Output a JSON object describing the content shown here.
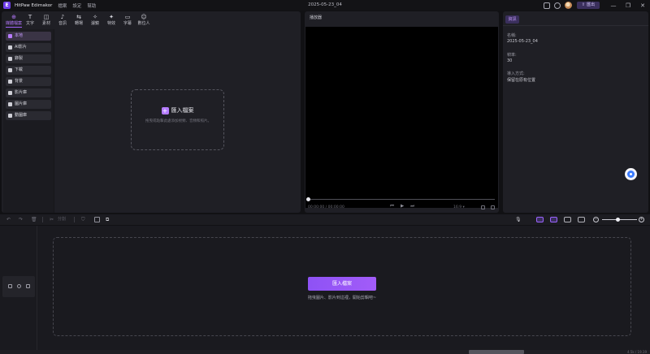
{
  "titlebar": {
    "app_name": "HitPaw Edimakor",
    "logo_letter": "E",
    "menus": [
      "檔案",
      "設定",
      "幫助"
    ],
    "document_title": "2025-05-23_04",
    "export_label": "匯出",
    "window_controls": [
      "—",
      "❐",
      "✕"
    ]
  },
  "toolbar": {
    "tools": [
      {
        "label": "媒體檔案",
        "icon": "media-icon",
        "glyph": "⊕",
        "active": true
      },
      {
        "label": "文字",
        "icon": "text-icon",
        "glyph": "T",
        "active": false
      },
      {
        "label": "素材",
        "icon": "sticker-icon",
        "glyph": "◫",
        "active": false
      },
      {
        "label": "音訊",
        "icon": "audio-icon",
        "glyph": "♪",
        "active": false
      },
      {
        "label": "轉場",
        "icon": "transition-icon",
        "glyph": "⇆",
        "active": false
      },
      {
        "label": "濾鏡",
        "icon": "filter-icon",
        "glyph": "✧",
        "active": false
      },
      {
        "label": "特效",
        "icon": "effect-icon",
        "glyph": "✦",
        "active": false
      },
      {
        "label": "字幕",
        "icon": "subtitle-icon",
        "glyph": "▭",
        "active": false
      },
      {
        "label": "數位人",
        "icon": "avatar-person-icon",
        "glyph": "☺",
        "active": false
      }
    ]
  },
  "sidebar": {
    "items": [
      {
        "label": "本地",
        "active": true
      },
      {
        "label": "AI影片",
        "active": false
      },
      {
        "label": "錄製",
        "active": false
      },
      {
        "label": "下載",
        "active": false
      },
      {
        "label": "背景",
        "active": false
      },
      {
        "label": "影片庫",
        "active": false
      },
      {
        "label": "圖片庫",
        "active": false
      },
      {
        "label": "動圖庫",
        "active": false
      }
    ]
  },
  "import_area": {
    "title": "匯入檔案",
    "hint": "拖曳或點擊此處添加視頻、音頻和照片。"
  },
  "player": {
    "title": "播放器",
    "time_current": "00:00:00",
    "time_total": "00:00:00",
    "aspect_ratio": "16:9",
    "controls": [
      "⏮",
      "▶",
      "⏭"
    ],
    "progress": 0
  },
  "info_panel": {
    "tab_label": "資訊",
    "fields": [
      {
        "label": "名稱:",
        "value": "2025-05-23_04"
      },
      {
        "label": "幀率:",
        "value": "30"
      },
      {
        "label": "導入方式:",
        "value": "保留在原有位置"
      }
    ]
  },
  "timeline_toolbar": {
    "split_label": "分割"
  },
  "timeline": {
    "import_button": "匯入檔案",
    "drop_hint": "拖曳圖片、影片到這裡，開始剪輯吧~",
    "status_text": "4.5k / 19.19"
  },
  "zoom": {
    "level": 0.45
  },
  "colors": {
    "accent": "#a463ff",
    "panel": "#1f1f25",
    "background": "#111114"
  }
}
